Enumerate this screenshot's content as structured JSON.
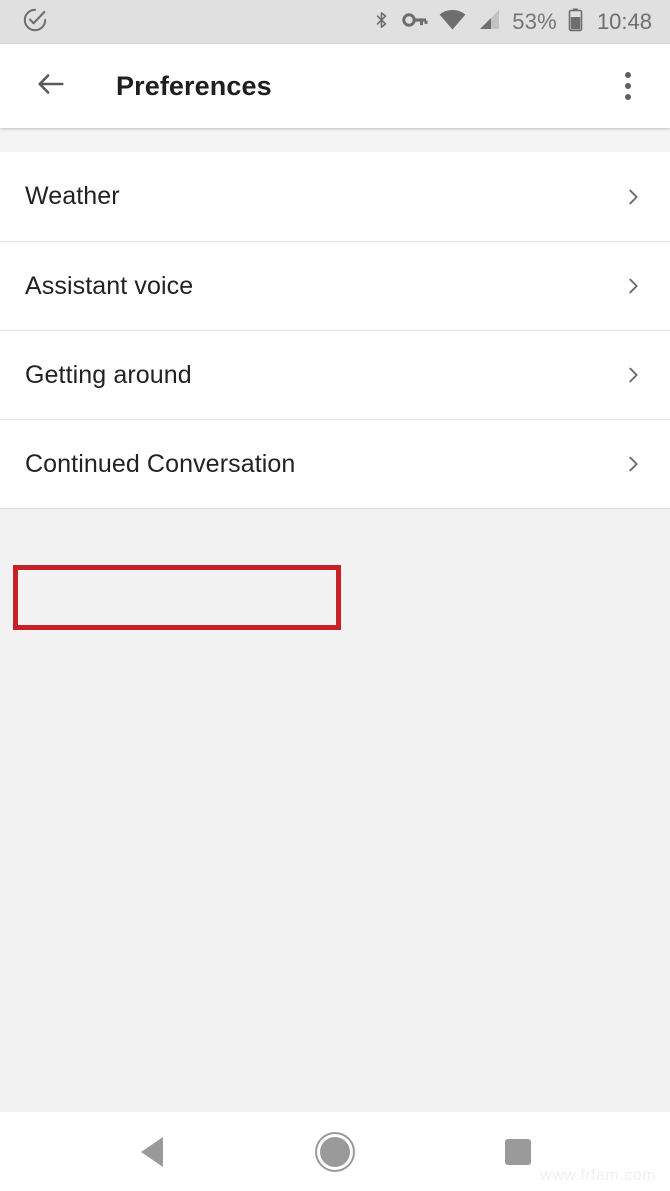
{
  "status_bar": {
    "notification_icon": "check-circle-icon",
    "icons": [
      "bluetooth-icon",
      "vpn-key-icon",
      "wifi-icon",
      "cellular-signal-icon"
    ],
    "battery_percent": "53%",
    "battery_icon": "battery-icon",
    "time": "10:48"
  },
  "app_bar": {
    "back_icon": "arrow-back-icon",
    "title": "Preferences",
    "overflow_icon": "more-vert-icon"
  },
  "settings_list": {
    "items": [
      {
        "label": "Weather",
        "chevron": "chevron-right-icon",
        "highlighted": false
      },
      {
        "label": "Assistant voice",
        "chevron": "chevron-right-icon",
        "highlighted": false
      },
      {
        "label": "Getting around",
        "chevron": "chevron-right-icon",
        "highlighted": false
      },
      {
        "label": "Continued Conversation",
        "chevron": "chevron-right-icon",
        "highlighted": true
      }
    ]
  },
  "highlight": {
    "color": "#c62127",
    "target_label": "Continued Conversation"
  },
  "nav_bar": {
    "back": "nav-back-icon",
    "home": "nav-home-icon",
    "recent": "nav-recent-apps-icon"
  },
  "watermark": {
    "text": "www.frfam.com"
  },
  "colors": {
    "status_bar_bg": "#e0e0e0",
    "app_bar_bg": "#ffffff",
    "content_bg": "#f2f2f2",
    "list_bg": "#ffffff",
    "divider": "#e4e4e4",
    "text_primary": "#222222",
    "icon_gray": "#5f5f5f"
  }
}
